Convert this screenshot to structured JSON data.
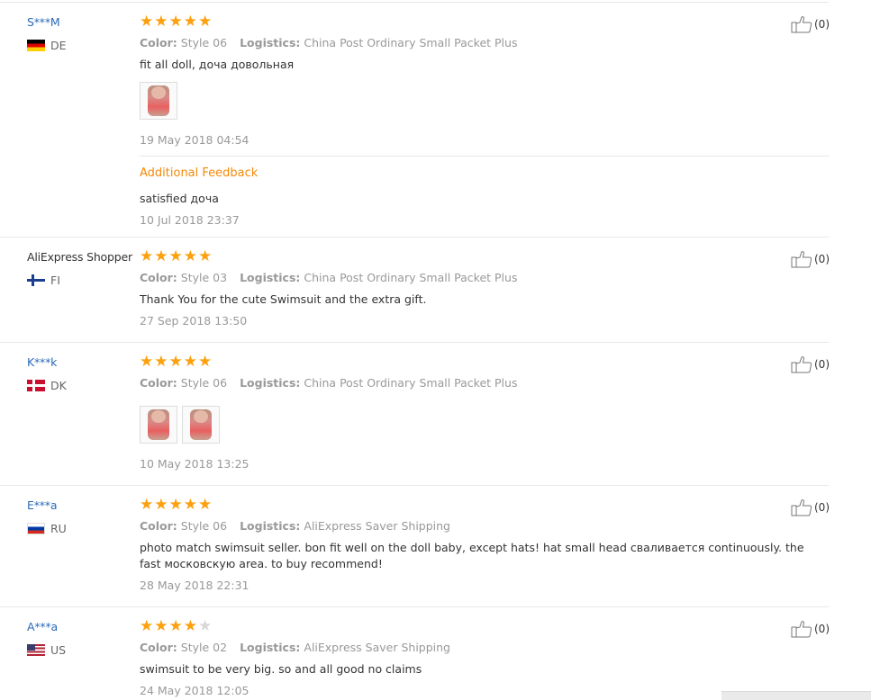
{
  "labels": {
    "color": "Color:",
    "logistics": "Logistics:",
    "additional_feedback": "Additional Feedback"
  },
  "colors": {
    "user_link": "#2a6ab8",
    "star": "#fda00d",
    "additional_feedback": "#f48a0a"
  },
  "reviews": [
    {
      "user": "S***M",
      "country": "DE",
      "stars": 5,
      "color": "Style 06",
      "logistics": "China Post Ordinary Small Packet Plus",
      "text": "fit all doll, доча довольная",
      "photos": 1,
      "date": "19 May 2018 04:54",
      "additional": {
        "text": "satisfied доча",
        "date": "10 Jul 2018 23:37"
      },
      "likes": "(0)"
    },
    {
      "user": "AliExpress Shopper",
      "country": "FI",
      "stars": 5,
      "color": "Style 03",
      "logistics": "China Post Ordinary Small Packet Plus",
      "text": "Thank You for the cute Swimsuit and the extra gift.",
      "photos": 0,
      "date": "27 Sep 2018 13:50",
      "likes": "(0)"
    },
    {
      "user": "K***k",
      "country": "DK",
      "stars": 5,
      "color": "Style 06",
      "logistics": "China Post Ordinary Small Packet Plus",
      "text": "",
      "photos": 2,
      "date": "10 May 2018 13:25",
      "likes": "(0)"
    },
    {
      "user": "E***a",
      "country": "RU",
      "stars": 5,
      "color": "Style 06",
      "logistics": "AliExpress Saver Shipping",
      "text": "photo match swimsuit seller. bon fit well on the doll baby, except hats! hat small head сваливается continuously. the fast московскую area. to buy recommend!",
      "photos": 0,
      "date": "28 May 2018 22:31",
      "likes": "(0)"
    },
    {
      "user": "A***a",
      "country": "US",
      "stars": 4,
      "color": "Style 02",
      "logistics": "AliExpress Saver Shipping",
      "text": "swimsuit to be very big. so and all good no claims",
      "photos": 0,
      "date": "24 May 2018 12:05",
      "likes": "(0)"
    }
  ]
}
